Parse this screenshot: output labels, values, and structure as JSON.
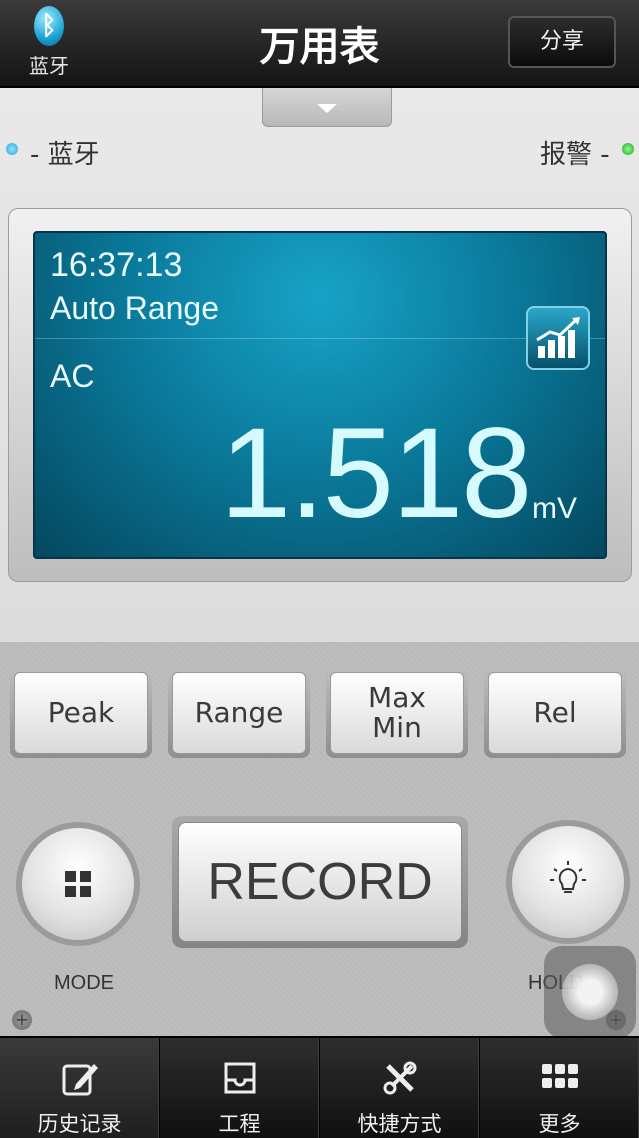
{
  "header": {
    "title": "万用表",
    "bluetooth_label": "蓝牙",
    "share_label": "分享"
  },
  "status": {
    "bluetooth": "- 蓝牙",
    "alarm": "报警 -",
    "bluetooth_color": "#2ba3dc",
    "alarm_color": "#1fa61f"
  },
  "display": {
    "time": "16:37:13",
    "range": "Auto Range",
    "mode": "AC",
    "value": "1.518",
    "unit": "mV"
  },
  "keys": [
    {
      "id": "peak",
      "label": "Peak"
    },
    {
      "id": "range",
      "label": "Range"
    },
    {
      "id": "maxmin",
      "label": "Max\nMin"
    },
    {
      "id": "rel",
      "label": "Rel"
    }
  ],
  "controls": {
    "record": "RECORD",
    "mode_label": "MODE",
    "hold_label": "HOLD"
  },
  "tabs": [
    {
      "label": "历史记录",
      "icon": "edit-icon"
    },
    {
      "label": "工程",
      "icon": "inbox-icon"
    },
    {
      "label": "快捷方式",
      "icon": "tools-icon"
    },
    {
      "label": "更多",
      "icon": "grid-icon"
    }
  ]
}
